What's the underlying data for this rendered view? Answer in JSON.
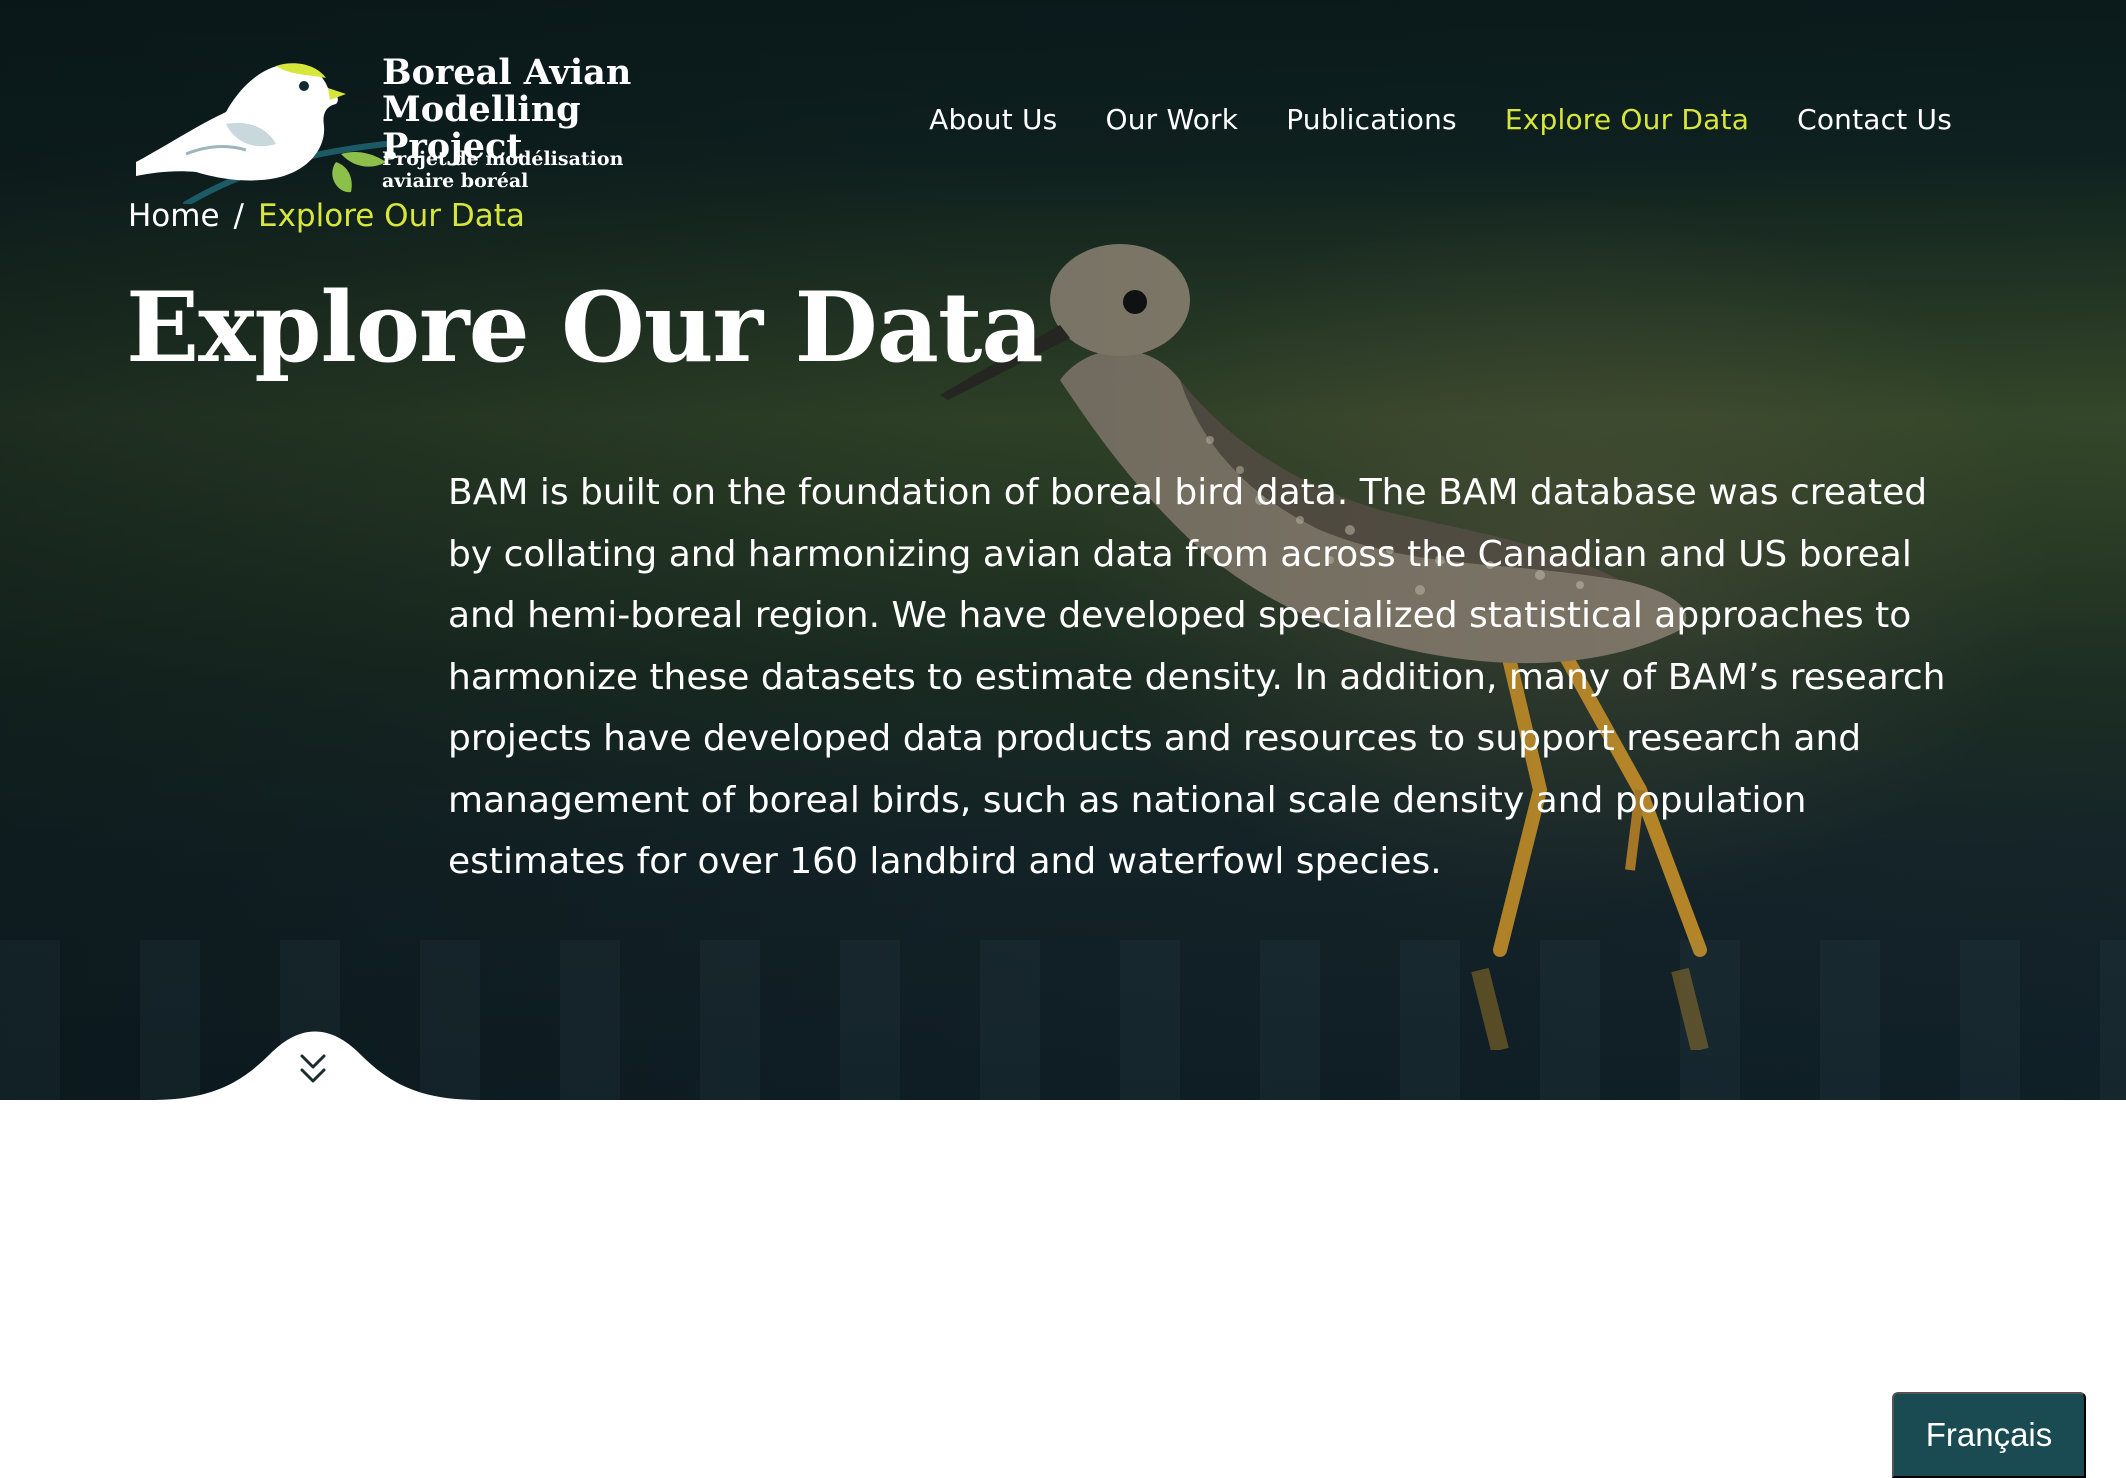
{
  "brand": {
    "title": "Boreal Avian\nModelling Project",
    "subtitle": "Projet de modélisation\naviaire boréal"
  },
  "nav": {
    "items": [
      {
        "label": "About Us"
      },
      {
        "label": "Our Work"
      },
      {
        "label": "Publications"
      },
      {
        "label": "Explore Our Data",
        "active": true
      },
      {
        "label": "Contact Us"
      }
    ]
  },
  "breadcrumb": {
    "home": "Home",
    "separator": "/",
    "current": "Explore Our Data"
  },
  "page": {
    "title": "Explore Our Data",
    "intro": "BAM is built on the foundation of boreal bird data. The BAM database was created by collating and harmonizing avian data from across the Canadian and US boreal and hemi-boreal region. We have developed specialized statistical approaches to harmonize these datasets to estimate density. In addition, many of BAM’s research projects have developed data products and resources to support research and management of boreal birds, such as national scale density and population estimates for over 160 landbird and waterfowl species."
  },
  "language": {
    "label": "Français"
  },
  "colors": {
    "accent": "#d7e63a",
    "lang_button": "#1a4a52",
    "hero_dark": "#0b1b1c"
  },
  "icons": {
    "logo": "sparrow-on-branch-logo",
    "scroll": "double-chevron-down-icon"
  }
}
